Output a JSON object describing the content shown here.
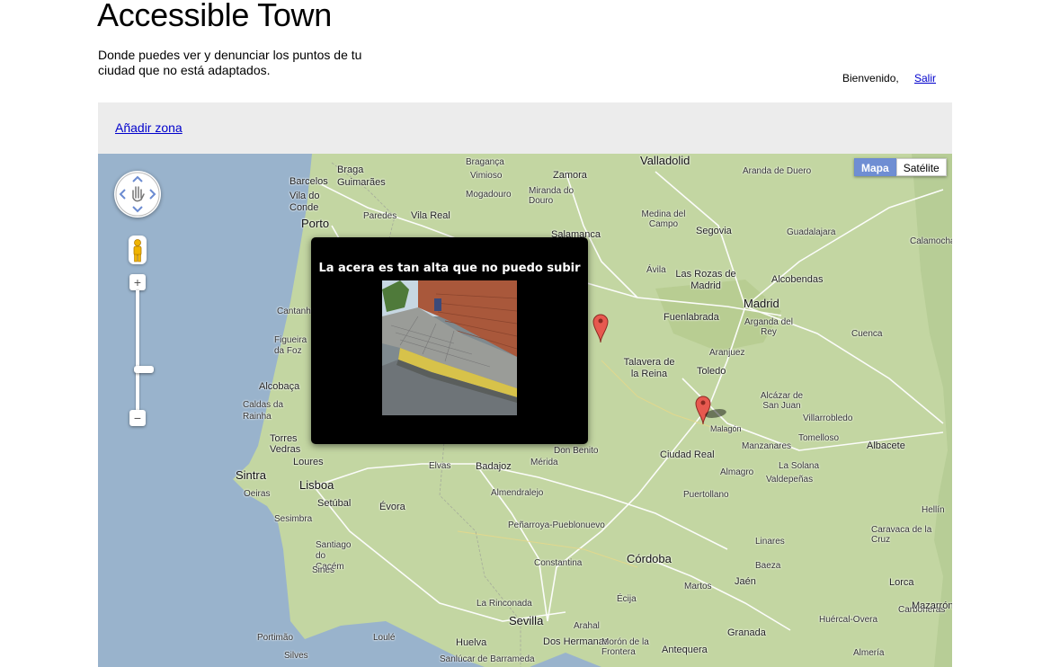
{
  "header": {
    "title": "Accessible Town",
    "subtitle": "Donde puedes ver y denunciar los puntos de tu ciudad que no está adaptados."
  },
  "user": {
    "welcome": "Bienvenido,",
    "logout": "Salir"
  },
  "toolbar": {
    "add_zone": "Añadir zona"
  },
  "map": {
    "type_buttons": {
      "map": "Mapa",
      "satellite": "Satélite",
      "active": "Mapa"
    },
    "places": [
      "Valladolid",
      "Braga",
      "Bragança",
      "Zamora",
      "Aranda de Duero",
      "Barcelos",
      "Vimioso",
      "Vila do Conde",
      "Guimarães",
      "Mogadouro",
      "Miranda do Douro",
      "Porto",
      "Paredes",
      "Vila Real",
      "Medina del Campo",
      "Segovia",
      "Salamanca",
      "Guadalajara",
      "Calamocha",
      "Ávila",
      "Las Rozas de Madrid",
      "Alcobendas",
      "Cantanhede",
      "Madrid",
      "Fuenlabrada",
      "Arganda del Rey",
      "Cuenca",
      "Aranjuez",
      "Figueira da Foz",
      "Talavera de la Reina",
      "Toledo",
      "Alcobaça",
      "Caldas da Rainha",
      "Alcázar de San Juan",
      "Villarrobledo",
      "Malagón",
      "Torres Vedras",
      "Don Benito",
      "Tomelloso",
      "Albacete",
      "Sintra",
      "Loures",
      "Elvas",
      "Badajoz",
      "Mérida",
      "Ciudad Real",
      "Manzanares",
      "Oeiras",
      "Lisboa",
      "Almagro",
      "La Solana",
      "Valdepeñas",
      "Almendralejo",
      "Puertollano",
      "Setúbal",
      "Évora",
      "Sesimbra",
      "Peñarroya-Pueblonuevo",
      "Hellín",
      "Santiago do Cacém",
      "Linares",
      "Caravaca de la Cruz",
      "Sines",
      "Lorca",
      "Córdoba",
      "Baeza",
      "Jaén",
      "Constantina",
      "La Rinconada",
      "Écija",
      "Martos",
      "Carboneras",
      "Mazarrón",
      "Sevilla",
      "Arahal",
      "Huércal-Overa",
      "Portimão",
      "Loulé",
      "Huelva",
      "Dos Hermanas",
      "Morón de la Frontera",
      "Antequera",
      "Granada",
      "Almería",
      "Silves",
      "Sanlúcar de Barrameda"
    ]
  },
  "popup": {
    "title": "La acera es tan alta que no puedo subir"
  },
  "colors": {
    "link": "#0000cc",
    "toolbar_bg": "#ececec",
    "map_land": "#c3d6a2",
    "map_sea": "#99b3cc",
    "maptype_active": "#6f8ed3",
    "marker": "#e7594f"
  }
}
